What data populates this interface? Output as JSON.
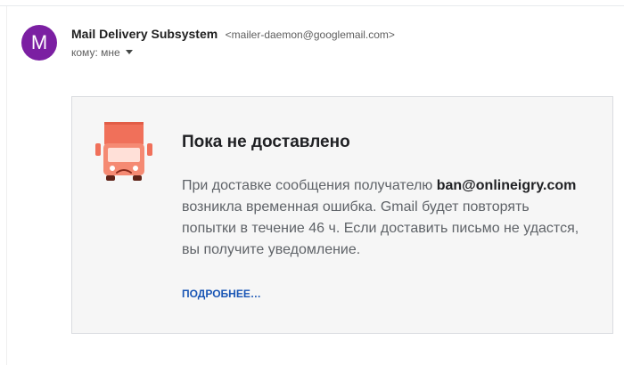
{
  "message": {
    "avatar_letter": "M",
    "avatar_color": "#7b1fa2",
    "sender_name": "Mail Delivery Subsystem",
    "sender_email": "<mailer-daemon@googlemail.com>",
    "recipient_label": "кому: мне"
  },
  "notice": {
    "icon": "sad-truck-icon",
    "title": "Пока не доставлено",
    "body_prefix": "При доставке сообщения получателю ",
    "recipient_address": "ban@onlineigry.com",
    "body_line2": "возникла временная ошибка. Gmail будет повторять",
    "body_line3": "попытки в течение 46 ч. Если доставить письмо не удастся,",
    "body_line4": "вы получите уведомление.",
    "more_link": "ПОДРОБНЕЕ…",
    "accent_color": "#f0705a"
  }
}
